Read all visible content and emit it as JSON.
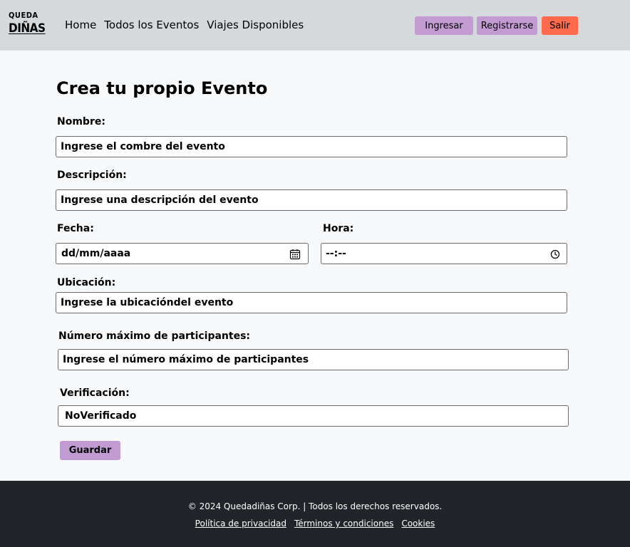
{
  "brand": {
    "line1": "QUEDA",
    "line2": "DIÑAS"
  },
  "nav": {
    "links": [
      "Home",
      "Todos los Eventos",
      "Viajes Disponibles"
    ],
    "login": "Ingresar",
    "register": "Registrarse",
    "logout": "Salir"
  },
  "form": {
    "title": "Crea tu propio Evento",
    "nombre": {
      "label": "Nombre:",
      "placeholder": "Ingrese el combre del evento"
    },
    "descripcion": {
      "label": "Descripción:",
      "placeholder": "Ingrese una descripción del evento"
    },
    "fecha": {
      "label": "Fecha:",
      "placeholder": "dd/mm/aaaa"
    },
    "hora": {
      "label": "Hora:",
      "placeholder": "--:--"
    },
    "ubicacion": {
      "label": "Ubicación:",
      "placeholder": "Ingrese la ubicacióndel evento"
    },
    "participantes": {
      "label": "Número máximo de participantes:",
      "placeholder": "Ingrese el número máximo de participantes"
    },
    "verificacion": {
      "label": "Verificación:",
      "value": "NoVerificado"
    },
    "save": "Guardar"
  },
  "footer": {
    "copyright": "© 2024 Quedadiñas Corp. | Todos los derechos reservados.",
    "links": [
      "Política de privacidad",
      "Términos y condiciones",
      "Cookies"
    ]
  },
  "colors": {
    "header_bg": "#d6d9dc",
    "accent_purple": "#c39bd3",
    "danger": "#ff6a4d",
    "footer_bg": "#212529"
  }
}
